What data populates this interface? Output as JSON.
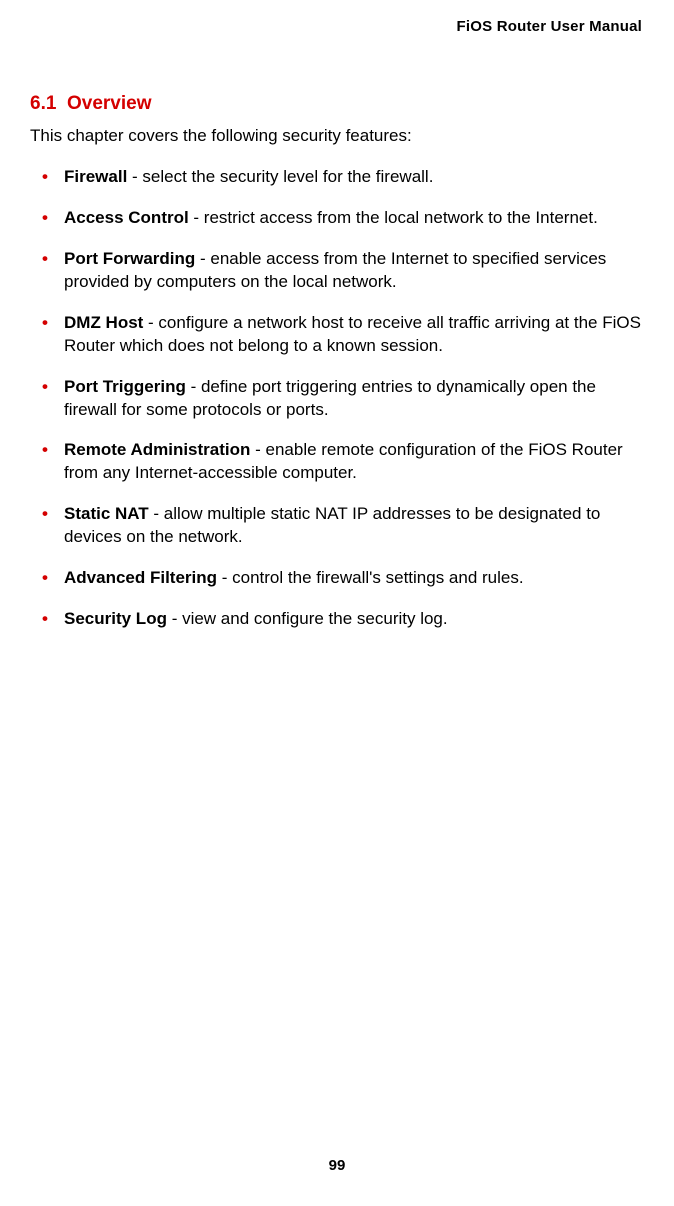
{
  "header": {
    "title": "FiOS Router User Manual"
  },
  "section": {
    "number": "6.1",
    "title": "Overview"
  },
  "intro": "This chapter covers the following security features:",
  "features": [
    {
      "term": "Firewall",
      "desc": " - select the security level for the firewall."
    },
    {
      "term": "Access Control",
      "desc": " - restrict access from the local network to the Internet."
    },
    {
      "term": "Port Forwarding",
      "desc": " - enable access from the Internet to specified services provided by computers on the local network."
    },
    {
      "term": "DMZ Host",
      "desc": " - configure a network host to receive all traffic arriving at the FiOS Router which does not belong to a known session."
    },
    {
      "term": "Port Triggering",
      "desc": " - define port triggering entries to dynamically open the firewall for some protocols or ports."
    },
    {
      "term": "Remote Administration",
      "desc": " - enable remote configuration of the FiOS Router from any Internet-accessible computer."
    },
    {
      "term": "Static NAT",
      "desc": " - allow multiple static NAT IP addresses to be designated to devices on the network."
    },
    {
      "term": "Advanced Filtering",
      "desc": " - control the firewall's settings and rules."
    },
    {
      "term": "Security Log",
      "desc": " - view and configure the security log."
    }
  ],
  "pageNumber": "99"
}
